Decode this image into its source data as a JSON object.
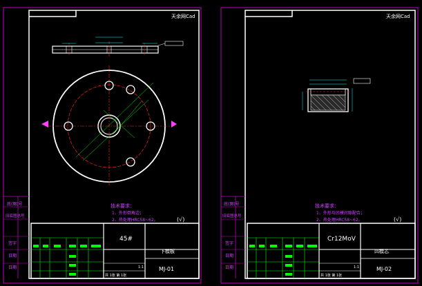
{
  "colors": {
    "background": "#000000",
    "frame": "#ffffff",
    "margin": "#c000c0",
    "centerline": "#ff2020",
    "note": "#d040ff",
    "green": "#00ff00",
    "cyan": "#00e0ff",
    "yellow": "#ffff00",
    "dim": "#00ffff"
  },
  "sheets": [
    {
      "id": "sheet-1",
      "logo": "天余网Cad",
      "left_labels": [
        "底(图)号",
        "旧底图总号",
        "签字",
        "日期",
        "日期"
      ],
      "tech_req": {
        "title": "技术要求：",
        "line1": "1、外形倒角边；",
        "line2": "2、热处理HRC58~62。"
      },
      "roughness": "(√)",
      "material": "45#",
      "part_name": "下模板",
      "drawing_no": "MJ-01",
      "scale": "1:1",
      "sheet_info": "共 1张  第 1张"
    },
    {
      "id": "sheet-2",
      "logo": "天余网Cad",
      "left_labels": [
        "底(图)号",
        "旧底图总号",
        "签字",
        "日期",
        "日期"
      ],
      "tech_req": {
        "title": "技术要求：",
        "line1": "1、外形与凹模间隙配合；",
        "line2": "2、热处理HRC58~62。"
      },
      "roughness": "(√)",
      "material": "Cr12MoV",
      "part_name": "凹模芯",
      "drawing_no": "MJ-02",
      "scale": "1:1",
      "sheet_info": "共 1张  第 1张"
    }
  ]
}
